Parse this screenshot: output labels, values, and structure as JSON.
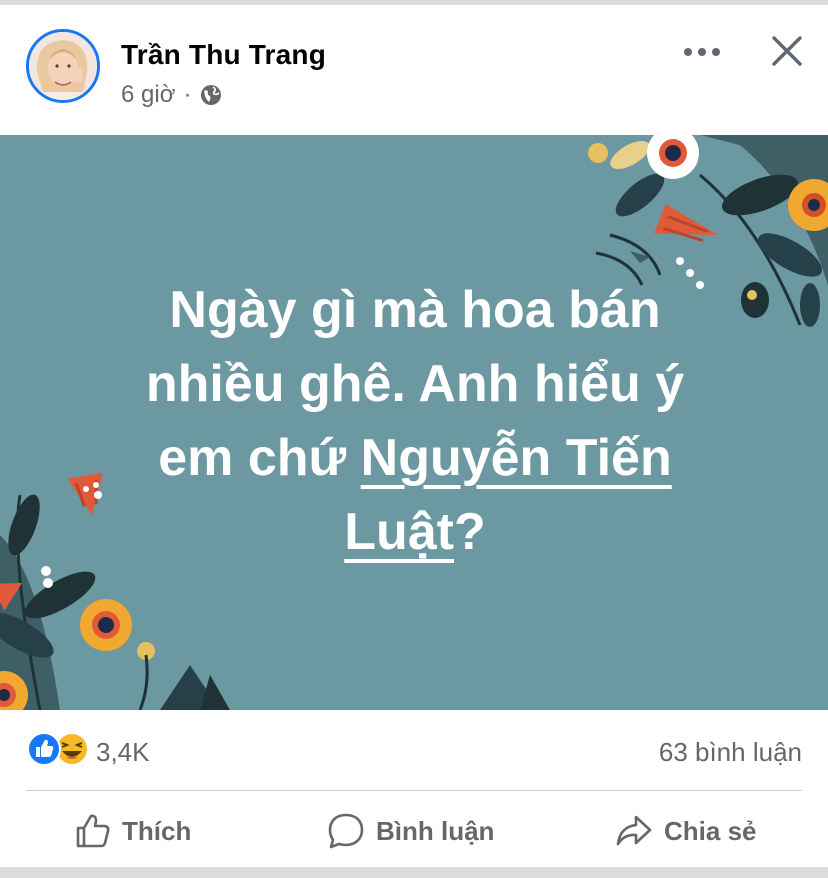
{
  "post": {
    "author": "Trần Thu Trang",
    "time": "6 giờ",
    "separator": "·",
    "audience_icon": "globe-icon",
    "text_lines": {
      "line1": "Ngày gì mà hoa bán",
      "line2": "nhiều ghê. Anh hiểu ý",
      "line3_prefix": "em chứ ",
      "line3_mention": "Nguyễn Tiến",
      "line4_mention": "Luật",
      "line4_suffix": "?"
    },
    "image_background": "#6b98a1"
  },
  "header_icons": {
    "more": "more-options-icon",
    "close": "close-icon"
  },
  "reactions": {
    "icons": [
      "like-reaction-icon",
      "haha-reaction-icon"
    ],
    "count": "3,4K",
    "comments": "63 bình luận"
  },
  "actions": {
    "like": "Thích",
    "comment": "Bình luận",
    "share": "Chia sẻ"
  },
  "colors": {
    "brand_blue": "#1877f2",
    "secondary_text": "#65676b",
    "haha_yellow": "#f7b928"
  }
}
